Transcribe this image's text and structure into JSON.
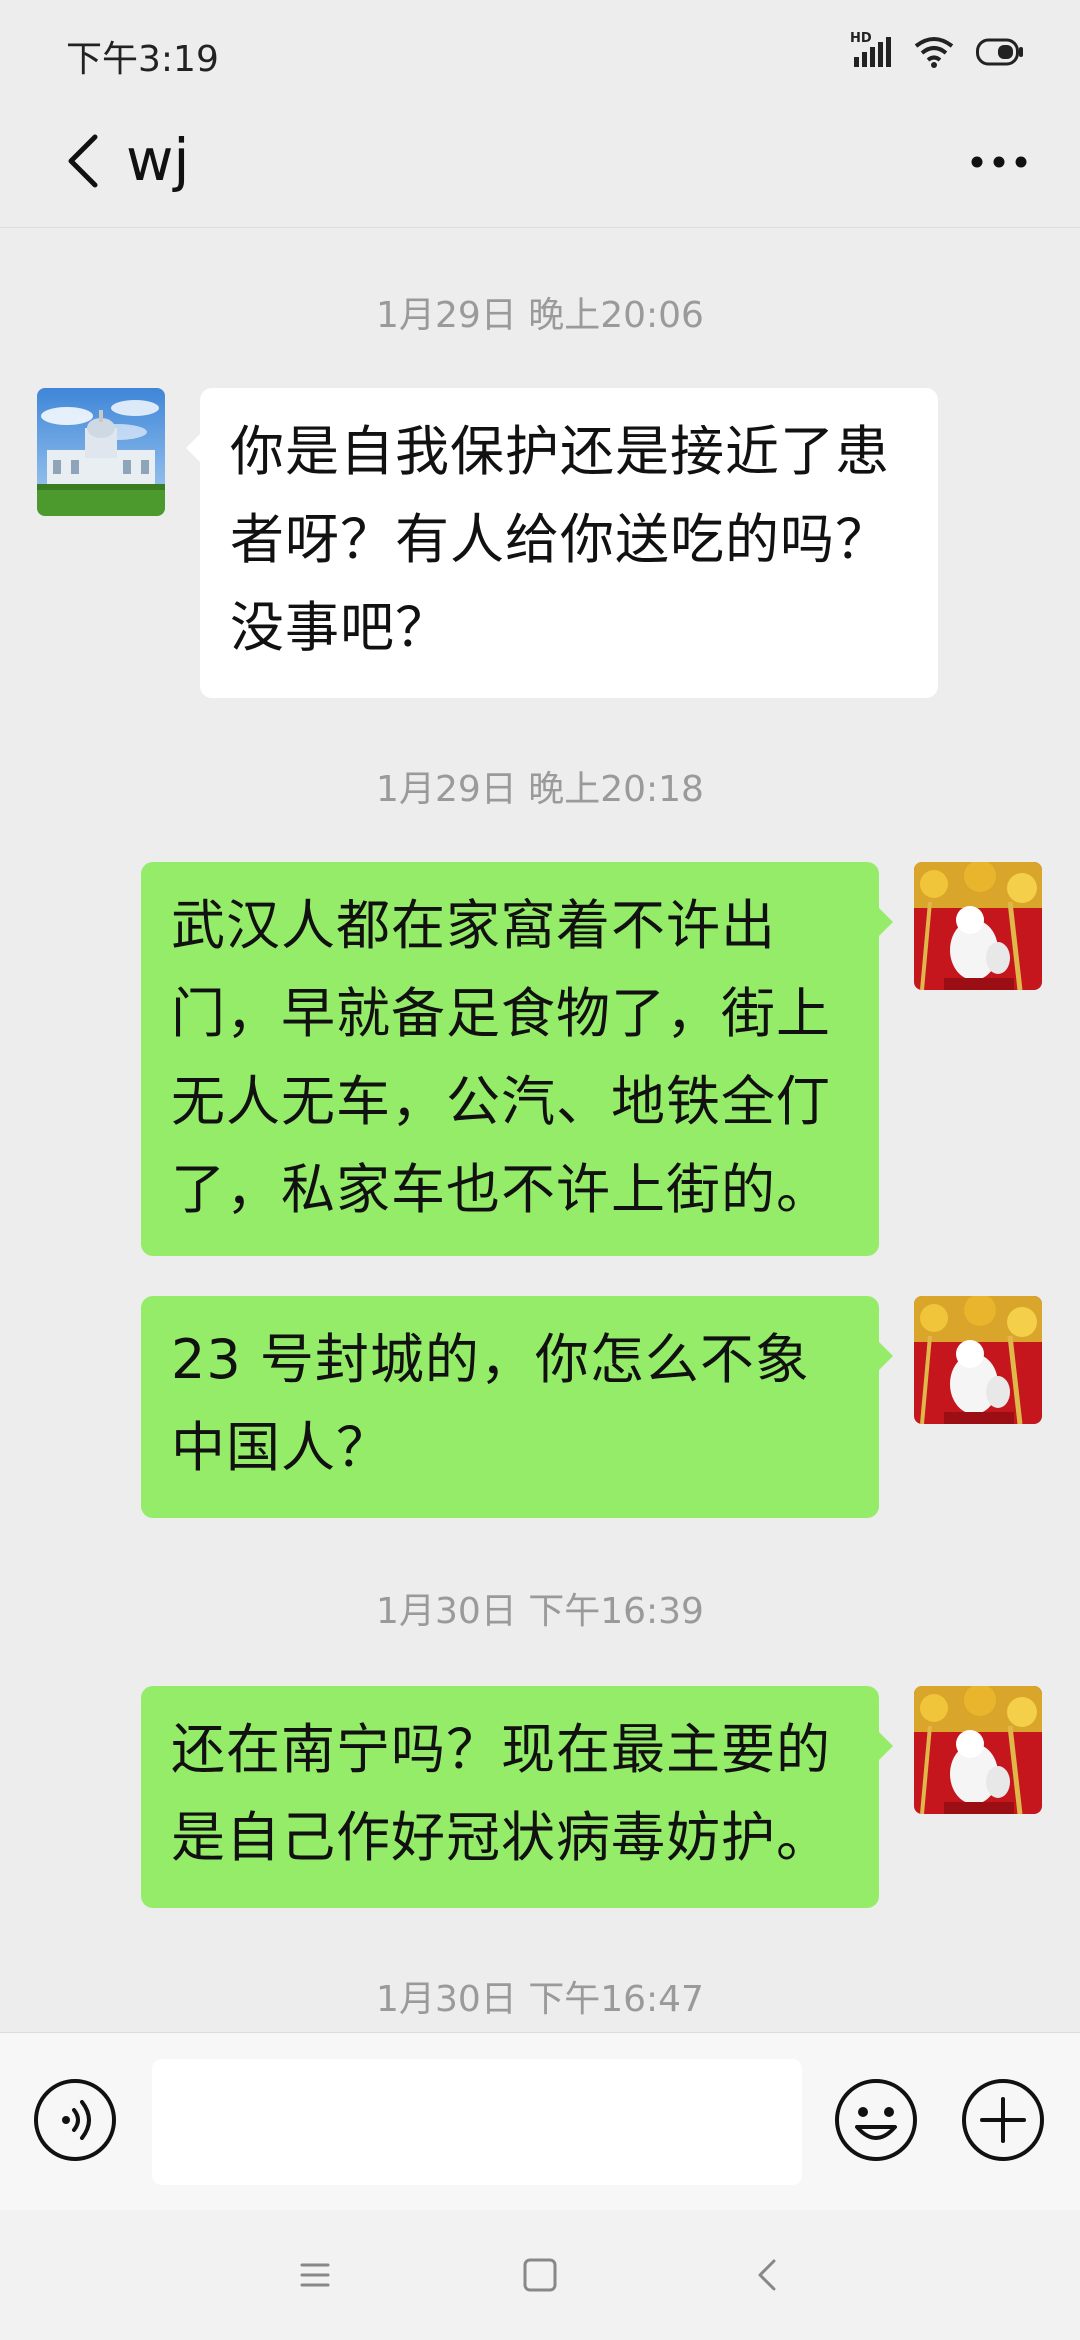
{
  "status_bar": {
    "time": "下午3:19",
    "network_label": "HD",
    "icons": [
      "signal-icon",
      "wifi-icon",
      "battery-icon"
    ]
  },
  "header": {
    "title": "wj",
    "back_icon": "chevron-left-icon",
    "more_icon": "more-dots-icon"
  },
  "messages": [
    {
      "type": "timestamp",
      "text": "1月29日 晚上20:06"
    },
    {
      "type": "incoming",
      "text": "你是自我保护还是接近了患者呀？有人给你送吃的吗？没事吧？"
    },
    {
      "type": "timestamp",
      "text": "1月29日 晚上20:18"
    },
    {
      "type": "outgoing",
      "text": "武汉人都在家窩着不许出门，早就备足食物了，街上无人无车，公汽、地铁全仃了，私家车也不许上街的。"
    },
    {
      "type": "outgoing",
      "text": "23 号封城的，你怎么不象中国人？"
    },
    {
      "type": "timestamp",
      "text": "1月30日 下午16:39"
    },
    {
      "type": "outgoing",
      "text": "还在南宁吗？现在最主要的是自己作好冠状病毒妨护。"
    },
    {
      "type": "timestamp",
      "text": "1月30日 下午16:47"
    }
  ],
  "input_bar": {
    "value": "",
    "placeholder": "",
    "icons": [
      "voice-icon",
      "emoji-icon",
      "plus-icon"
    ]
  },
  "nav_bar": {
    "icons": [
      "menu-icon",
      "home-icon",
      "back-icon"
    ]
  },
  "colors": {
    "background": "#ededed",
    "outgoing_bubble": "#95ec69",
    "incoming_bubble": "#ffffff",
    "timestamp_text": "#9a9a9a"
  }
}
